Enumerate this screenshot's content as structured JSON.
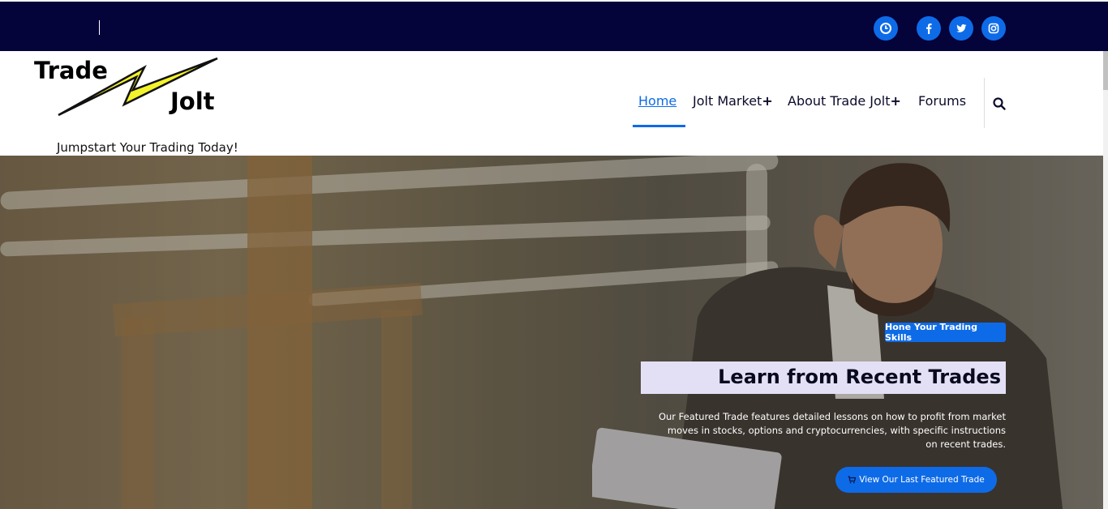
{
  "topbar": {
    "social": [
      {
        "name": "clock-icon"
      },
      {
        "name": "facebook-icon"
      },
      {
        "name": "twitter-icon"
      },
      {
        "name": "instagram-icon"
      }
    ],
    "accent": "#0e6be8",
    "background": "#04033a"
  },
  "header": {
    "logo": {
      "line1": "Trade",
      "line2": "Jolt",
      "bolt_color": "#f3f32b"
    },
    "tagline": "Jumpstart Your Trading Today!",
    "nav": [
      {
        "label": "Home",
        "has_submenu": false,
        "active": true
      },
      {
        "label": "Jolt Market",
        "has_submenu": true,
        "active": false
      },
      {
        "label": "About Trade Jolt",
        "has_submenu": true,
        "active": false
      },
      {
        "label": "Forums",
        "has_submenu": false,
        "active": false
      }
    ],
    "submenu_symbol": "+"
  },
  "hero": {
    "badge": "Hone Your Trading Skills",
    "title": "Learn from Recent Trades",
    "description": "Our Featured Trade features detailed lessons on how to profit from market moves in stocks, options and cryptocurrencies, with specific instructions on recent trades.",
    "cta_label": "View Our Last Featured Trade",
    "cta_icon": "cart-icon"
  }
}
